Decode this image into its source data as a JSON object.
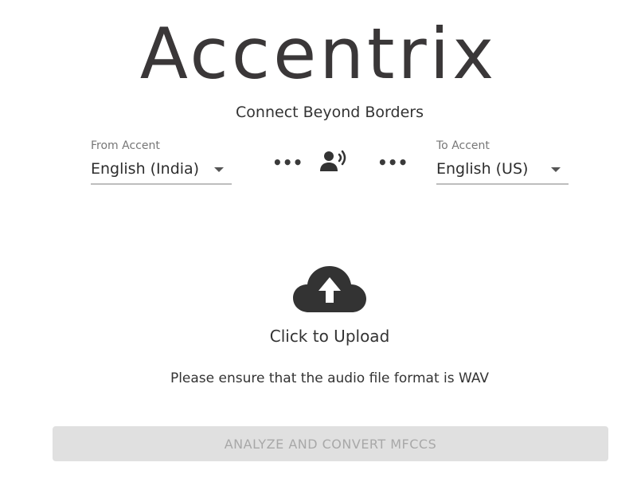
{
  "app": {
    "logo_text": "Accentrix",
    "tagline": "Connect Beyond Borders"
  },
  "from_accent": {
    "label": "From Accent",
    "value": "English (India)"
  },
  "to_accent": {
    "label": "To Accent",
    "value": "English (US)"
  },
  "connector": {
    "left_dots": "•••",
    "right_dots": "•••",
    "icon": "speaker-voice-icon"
  },
  "upload": {
    "icon": "cloud-upload-icon",
    "label": "Click to Upload"
  },
  "notice": "Please ensure that the audio file format is WAV",
  "analyze_button": {
    "label": "ANALYZE AND CONVERT MFCCS",
    "disabled": true
  },
  "colors": {
    "text_dark": "#3a3738",
    "button_bg_disabled": "#e0e0e0",
    "button_text_disabled": "#a8a8a8",
    "underline": "#bdbdbd"
  }
}
